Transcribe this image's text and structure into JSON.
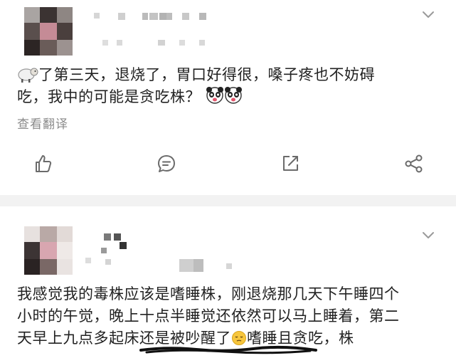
{
  "posts": [
    {
      "text_line1": "了第三天，退烧了，胃口好得很，嗓子疼也不妨碍",
      "text_line2": "吃，我中的可能是贪吃株？",
      "translate_label": "查看翻译"
    },
    {
      "text_line1": "我感觉我的毒株应该是嗜睡株，刚退烧那几天下午睡四个",
      "text_line2": "小时的午觉，晚上十点半睡觉还依然可以马上睡着，第二",
      "text_line3a": "天早上九点多起床还是被吵醒了",
      "text_line3b": "嗜睡且贪吃，株"
    }
  ],
  "icons": {
    "like": "thumbs-up-icon",
    "comment": "comment-icon",
    "forward": "forward-icon",
    "share": "share-icon",
    "menu": "chevron-down-icon",
    "sheep": "sheep-emoji",
    "panda": "panda-face-emoji",
    "sleepy": "sleepy-face-emoji"
  },
  "colors": {
    "text": "#222222",
    "muted": "#8a8a8a",
    "icon": "#6b6b6b",
    "separator": "#f2f2f2"
  }
}
